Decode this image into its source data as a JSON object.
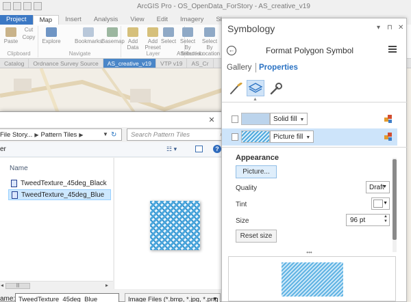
{
  "app": {
    "title": "ArcGIS Pro - OS_OpenData_ForStory - AS_creative_v19",
    "tabs": [
      "Project",
      "Map",
      "Insert",
      "Analysis",
      "View",
      "Edit",
      "Imagery",
      "Share"
    ],
    "ribbon": {
      "clipboard": {
        "paste": "Paste",
        "cut": "Cut",
        "copy": "Copy",
        "group": "Clipboard"
      },
      "navigate": {
        "explore": "Explore",
        "bookmarks": "Bookmarks",
        "group": "Navigate"
      },
      "layer": {
        "basemap": "Basemap",
        "add_data": "Add Data",
        "add_preset": "Add Preset",
        "group": "Layer"
      },
      "selection": {
        "select": "Select",
        "select_by_attributes": "Select By Attributes",
        "select_by_location": "Select By Location",
        "group": "Selection"
      }
    },
    "view_tabs": [
      "Catalog",
      "Ordnance Survey Source",
      "AS_creative_v19",
      "VTP v19",
      "AS_Cr"
    ]
  },
  "dialog": {
    "breadcrumb": [
      "File Story...",
      "Pattern Tiles"
    ],
    "search_placeholder": "Search Pattern Tiles",
    "toolbar_label": "er",
    "column_header": "Name",
    "files": [
      {
        "name": "TweedTexture_45deg_Black",
        "selected": false
      },
      {
        "name": "TweedTexture_45deg_Blue",
        "selected": true
      }
    ],
    "filename_label": "ame:",
    "filename_value": "TweedTexture_45deg_Blue",
    "filetype_value": "Image Files (*.bmp, *.jpg, *.png",
    "close": "✕"
  },
  "symbology": {
    "title": "Symbology",
    "header": "Format Polygon Symbol",
    "nav": {
      "gallery": "Gallery",
      "properties": "Properties"
    },
    "layers": [
      {
        "type": "Solid fill",
        "swatch_color": "#bcd4ec"
      },
      {
        "type": "Picture fill",
        "swatch_color": "#5aa8d8"
      }
    ],
    "section": "Appearance",
    "picture_button": "Picture...",
    "quality": {
      "label": "Quality",
      "value": "Draft"
    },
    "tint": {
      "label": "Tint",
      "color": "#ffffff"
    },
    "size": {
      "label": "Size",
      "value": "96  pt"
    },
    "reset_button": "Reset size",
    "splitter": "•••",
    "accent": "#2a72c3"
  }
}
